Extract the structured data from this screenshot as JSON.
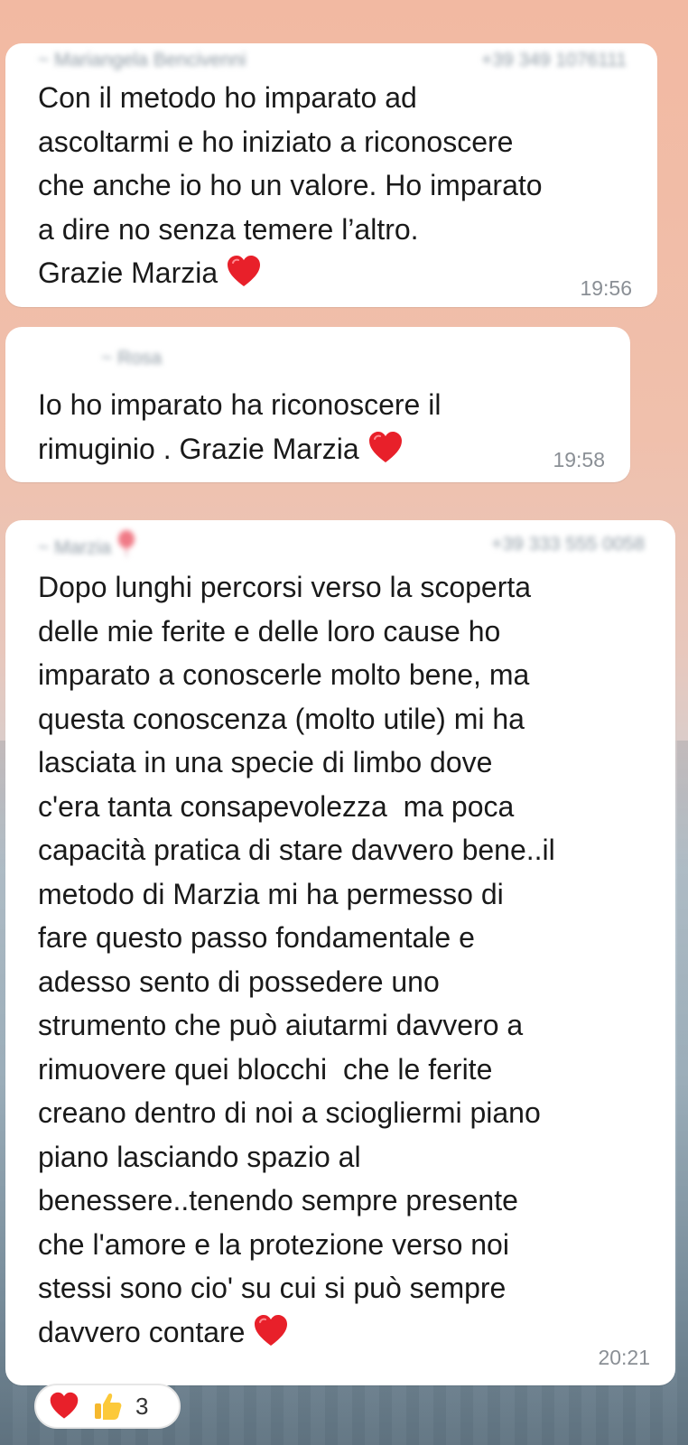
{
  "messages": [
    {
      "sender_blurred": "~ Mariangela Bencivenni",
      "phone_blurred": "+39 349 1076111",
      "text": "Con il metodo ho imparato ad\nascoltarmi e ho iniziato a riconoscere\nche anche io ho un valore. Ho imparato\na dire no senza temere l’altro.\nGrazie Marzia",
      "emoji": "red-heart",
      "time": "19:56"
    },
    {
      "sender_blurred": "~ Rosa",
      "phone_blurred": "",
      "text": "Io ho imparato ha riconoscere il\nrimuginio . Grazie Marzia",
      "emoji": "red-heart",
      "time": "19:58"
    },
    {
      "sender_blurred": "~ Marzia",
      "phone_blurred": "+39 333 555 0058",
      "text": "Dopo lunghi percorsi verso la scoperta\ndelle mie ferite e delle loro cause ho\nimparato a conoscerle molto bene, ma\nquesta conoscenza (molto utile) mi ha\nlasciata in una specie di limbo dove\nc'era tanta consapevolezza  ma poca\ncapacità pratica di stare davvero bene..il\nmetodo di Marzia mi ha permesso di\nfare questo passo fondamentale e\nadesso sento di possedere uno\nstrumento che può aiutarmi davvero a\nrimuovere quei blocchi  che le ferite\ncreano dentro di noi a sciogliermi piano\npiano lasciando spazio al\nbenessere..tenendo sempre presente\nche l'amore e la protezione verso noi\nstessi sono cio' su cui si può sempre\ndavvero contare",
      "emoji": "red-heart",
      "time": "20:21"
    }
  ],
  "reactions": {
    "icons": [
      "red-heart",
      "thumbs-up"
    ],
    "count": "3"
  },
  "colors": {
    "bubble": "#ffffff",
    "heart": "#e8202a",
    "time": "#8a8f95"
  }
}
